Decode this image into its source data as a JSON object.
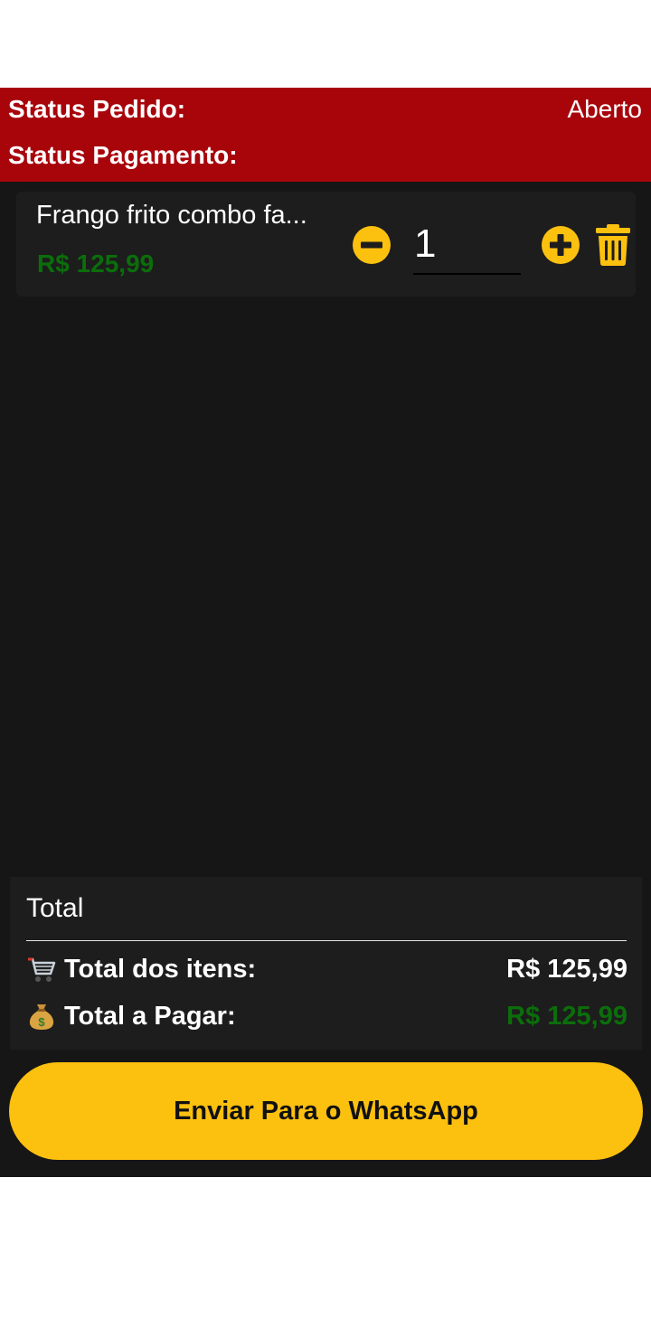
{
  "status": {
    "order_label": "Status Pedido:",
    "order_value": "Aberto",
    "payment_label": "Status Pagamento:",
    "payment_value": ""
  },
  "cart": {
    "items": [
      {
        "name": "Frango frito combo fa...",
        "price": "R$ 125,99",
        "quantity": "1",
        "minus_icon": "minus-circle-icon",
        "plus_icon": "plus-circle-icon",
        "delete_icon": "trash-icon"
      }
    ]
  },
  "totals": {
    "title": "Total",
    "items_icon": "shopping-cart-icon",
    "items_label": "Total dos itens:",
    "items_value": "R$ 125,99",
    "pay_icon": "money-bag-icon",
    "pay_label": "Total a Pagar:",
    "pay_value": "R$ 125,99"
  },
  "actions": {
    "send_label": "Enviar Para o WhatsApp"
  },
  "colors": {
    "status_bar": "#a8050b",
    "background": "#161616",
    "card": "#1d1d1d",
    "accent": "#fcc00f",
    "price_green": "#0b6e0b"
  }
}
